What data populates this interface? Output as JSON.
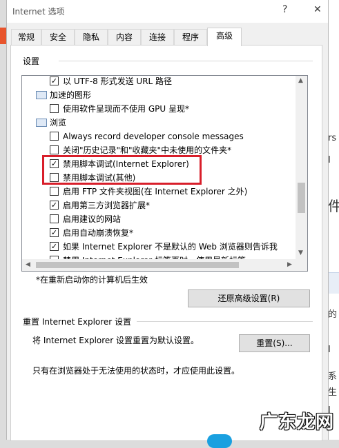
{
  "window": {
    "title": "Internet 选项",
    "help_glyph": "?",
    "close_glyph": "✕"
  },
  "tabs": [
    {
      "label": "常规"
    },
    {
      "label": "安全"
    },
    {
      "label": "隐私"
    },
    {
      "label": "内容"
    },
    {
      "label": "连接"
    },
    {
      "label": "程序"
    },
    {
      "label": "高级",
      "active": true
    }
  ],
  "settings": {
    "group_label": "设置",
    "items": [
      {
        "kind": "check",
        "checked": true,
        "label": "以 UTF-8 形式发送 URL 路径"
      },
      {
        "kind": "folder",
        "label": "加速的图形"
      },
      {
        "kind": "check",
        "checked": false,
        "label": "使用软件呈现而不使用 GPU 呈现*"
      },
      {
        "kind": "folder",
        "label": "浏览"
      },
      {
        "kind": "check",
        "checked": false,
        "label": "Always record developer console messages"
      },
      {
        "kind": "check",
        "checked": false,
        "label": "关闭\"历史记录\"和\"收藏夹\"中未使用的文件夹*"
      },
      {
        "kind": "check",
        "checked": true,
        "label": "禁用脚本调试(Internet Explorer)"
      },
      {
        "kind": "check",
        "checked": false,
        "label": "禁用脚本调试(其他)"
      },
      {
        "kind": "check",
        "checked": false,
        "label": "启用 FTP 文件夹视图(在 Internet Explorer 之外)"
      },
      {
        "kind": "check",
        "checked": true,
        "label": "启用第三方浏览器扩展*"
      },
      {
        "kind": "check",
        "checked": false,
        "label": "启用建议的网站"
      },
      {
        "kind": "check",
        "checked": true,
        "label": "启用自动崩溃恢复*"
      },
      {
        "kind": "check",
        "checked": true,
        "label": "如果 Internet Explorer 不是默认的 Web 浏览器则告诉我"
      },
      {
        "kind": "check",
        "checked": false,
        "label": "禁用 Internet Explorer 标签页时，使用最新标签"
      }
    ],
    "check_glyph": "✓",
    "restart_note": "*在重新启动你的计算机后生效",
    "restore_button": "还原高级设置(R)"
  },
  "reset": {
    "group_label": "重置 Internet Explorer 设置",
    "description": "将 Internet Explorer 设置重置为默认设置。",
    "button": "重置(S)...",
    "warning": "只有在浏览器处于无法使用的状态时，才应使用此设置。"
  },
  "background": {
    "fragments": [
      "rs",
      "I",
      "件",
      "的",
      "I",
      "系",
      "生",
      "I"
    ]
  },
  "watermark": "广东龙网"
}
